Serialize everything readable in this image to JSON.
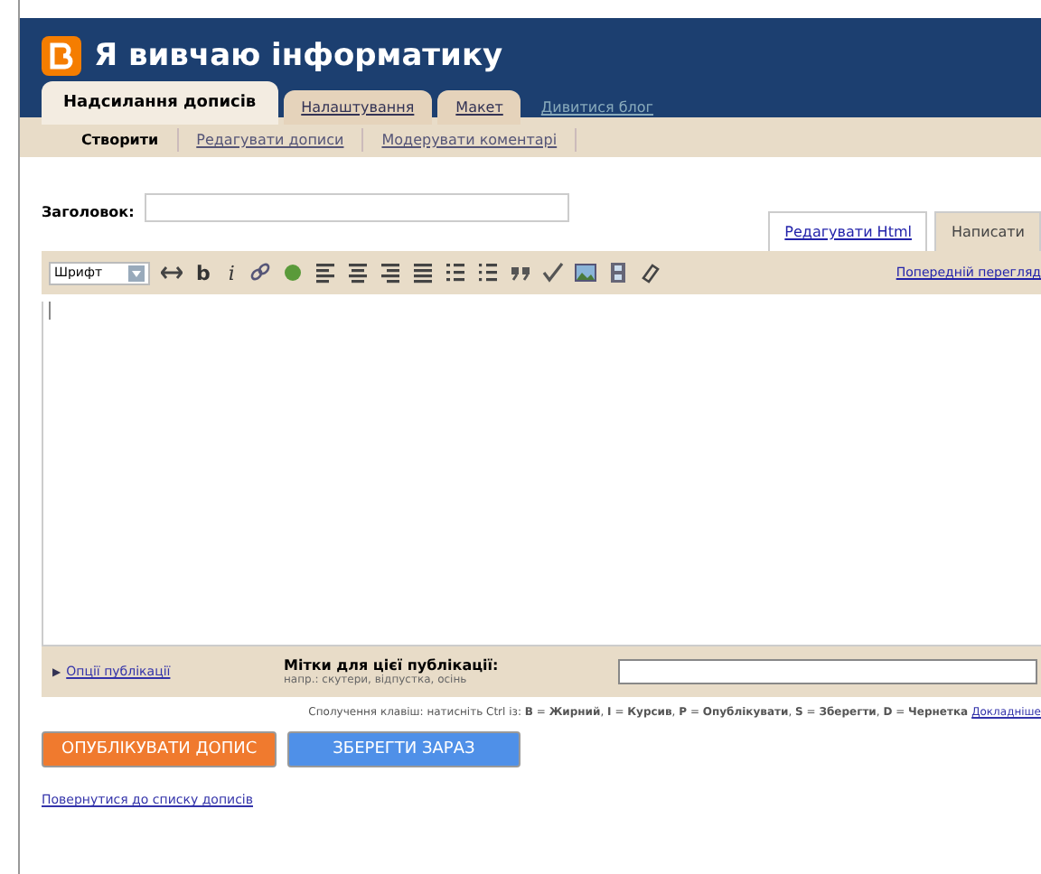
{
  "header": {
    "title": "Я вивчаю інформатику"
  },
  "tabs": [
    {
      "label": "Надсилання дописів",
      "selected": true
    },
    {
      "label": "Налаштування",
      "selected": false
    },
    {
      "label": "Макет",
      "selected": false
    }
  ],
  "view_blog_link": "Дивитися блог",
  "subtabs": [
    {
      "label": "Створити",
      "selected": true
    },
    {
      "label": "Редагувати дописи",
      "selected": false
    },
    {
      "label": "Модерувати коментарі",
      "selected": false
    }
  ],
  "title_field": {
    "label": "Заголовок:"
  },
  "editor_tabs": [
    {
      "label": "Редагувати Html",
      "selected": false
    },
    {
      "label": "Написати",
      "selected": true
    }
  ],
  "toolbar": {
    "font_select": "Шрифт",
    "bold": "b",
    "italic": "i",
    "preview_link": "Попередній перегляд"
  },
  "options": {
    "toggle": "▶",
    "link": "Опції публікації",
    "labels_title": "Мітки для цієї публікації:",
    "labels_hint": "напр.: скутери, відпустка, осінь"
  },
  "shortcuts": {
    "text": "Сполучення клавіш: натисніть Ctrl із: **B** = **Жирний**, **I** = **Курсив**, **P** = **Опублікувати**, **S** = **Зберегти**, **D** = **Чернетка**",
    "link": "Докладніше"
  },
  "buttons": [
    {
      "label": "ОПУБЛІКУВАТИ ДОПИС",
      "kind": "publish"
    },
    {
      "label": "ЗБЕРЕГТИ ЗАРАЗ",
      "kind": "save"
    }
  ],
  "back_link": "Повернутися до списку дописів"
}
